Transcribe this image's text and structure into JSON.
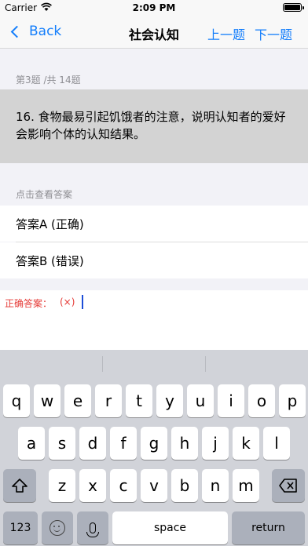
{
  "status": {
    "carrier": "Carrier",
    "time": "2:09 PM"
  },
  "nav": {
    "back_label": "Back",
    "title": "社会认知",
    "prev_label": "上一题",
    "next_label": "下一题"
  },
  "progress_text": "第3题 /共 14题",
  "question": "16. 食物最易引起饥饿者的注意，说明认知者的爱好会影响个体的认知结果。",
  "answer_hint": "点击查看答案",
  "options": [
    {
      "label": "答案A (正确)"
    },
    {
      "label": "答案B (错误)"
    }
  ],
  "correct_answer": {
    "label": "正确答案：",
    "value": "(×)"
  },
  "keyboard": {
    "row1": [
      "q",
      "w",
      "e",
      "r",
      "t",
      "y",
      "u",
      "i",
      "o",
      "p"
    ],
    "row2": [
      "a",
      "s",
      "d",
      "f",
      "g",
      "h",
      "j",
      "k",
      "l"
    ],
    "row3": [
      "z",
      "x",
      "c",
      "v",
      "b",
      "n",
      "m"
    ],
    "numbers_label": "123",
    "space_label": "space",
    "return_label": "return"
  }
}
